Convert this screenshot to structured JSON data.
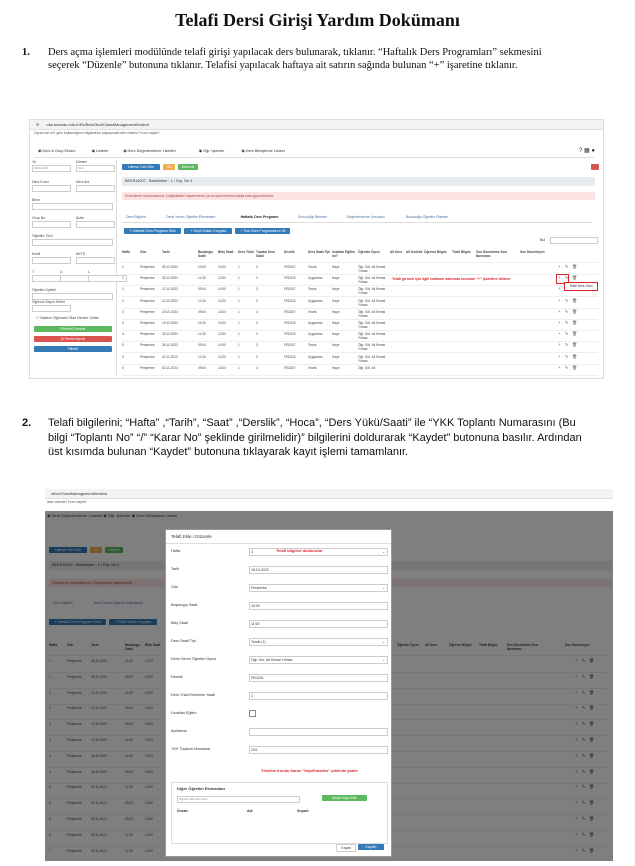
{
  "title": "Telafi Dersi Girişi Yardım Dokümanı",
  "steps": [
    {
      "num": "1.",
      "text": "Ders açma işlemleri modülünde telafi girişi yapılacak ders bulunarak, tıklanır. “Haftalık Ders Programları” sekmesini seçerek “Düzenle” butonuna tıklanır. Telafisi yapılacak haftaya ait satırın sağında bulunan “+” işaretine tıklanır."
    },
    {
      "num": "2.",
      "text": "Telafi bilgilerini; “Hafta” ,“Tarih”, “Saat” ,“Derslik”, “Hoca”, “Ders Yükü/Saati” ile “YKK Toplantı Numarasını (Bu bilgi “Toplantı No” “/” “Karar No” şeklinde girilmelidir)” bilgilerini doldurarak “Kaydet” butonuna basılır. Ardından üst kısımda bulunan “Kaydet” butonuna tıklayarak kayıt işlemi tamamlanır."
    }
  ],
  "shot1": {
    "url": "obs.batman.edu.tr/Ek/BelsOkul/ClassManagement/Index#",
    "notice": "Oyunu'lar mi? girin kullandığınız bilgilerinizi paylaşmak ister misiniz? Kuru sayfa?",
    "topnav": [
      "Ders & Grup Ekranı",
      "Listeler",
      "Ders Değerlendirme Listeleri",
      "Öğr. İşlemler",
      "Ders Birleştirme Listesi"
    ],
    "left_labels": [
      "Yıl",
      "Dönem",
      "Ders Kodu",
      "Ders Adı",
      "Birim",
      "Grup No",
      "Şube",
      "Öğretim Türü",
      "Kredi",
      "AKTS",
      "T",
      "U",
      "L",
      "Öğretim Üyeleri",
      "Öğrenci Sayısı Kriteri"
    ],
    "year_value": "2023-2024",
    "term_value": "Güz",
    "left_checkbox_label": "Sadece Öğrencisi Olan Dersler Gelsin",
    "left_buttons": [
      "Filtreleri Temizle",
      "Şi Temsil Ayrıntı",
      "Filtrele"
    ],
    "actions": [
      "Listeye Geri Dön",
      "Sil",
      "Düzenle"
    ],
    "course_bar": "BEKS14007 - Badminton - 1 / Grp. No:1",
    "warning": "Düzenleme modundasınız. Değişiklikleri kaydetmeniz ya da iptal etmeniz başka hata giysindenizde.",
    "tabs": [
      "Ders Bilgileri",
      "Dersi Veren Öğretim Elemanları",
      "Haftalık Ders Programı",
      "Sonuç/Ağı Birimler",
      "Değerlendirme Unsurları",
      "Bazadağa Öğretim Planları"
    ],
    "tab_buttons": [
      "Haftalık Ders Programı Ekle",
      "Seçili Kalları Kopyala",
      "Tüm Ders Programlarını Sil"
    ],
    "search_label": "Bul",
    "columns": [
      "Hafta",
      "Gün",
      "Tarih",
      "Başlangıç Saati",
      "Bitiş Saati",
      "Ders Yükü",
      "Toplam Ders Saati",
      "Derslik",
      "Ders Saati Tipi",
      "Uzaktan Eğitim mi?",
      "Öğretim Üyesi",
      "Alt Ders",
      "Alt Kod/Alt",
      "Öğrenci Bilgisi",
      "Telafi Bilgisi",
      "Son Düzenleme Sıra Numarası",
      "Son Düzenleyen"
    ],
    "rows": [
      [
        "1",
        "Perşembe",
        "05.10.2023",
        "10:00",
        "12:00",
        "1",
        "3",
        "FED207",
        "Teorik",
        "Hayır",
        "Öğr. Gör. Ali Kemal Yılmaz"
      ],
      [
        "1",
        "Perşembe",
        "05.10.2023",
        "11:00",
        "12:00",
        "1",
        "3",
        "FED242",
        "Uygulama",
        "Hayır",
        "Öğr. Gör. Ali Kemal Yılmaz"
      ],
      [
        "2",
        "Perşembe",
        "12.10.2023",
        "09:00",
        "10:00",
        "1",
        "3",
        "FED207",
        "Teorik",
        "Hayır",
        "Öğr. Gör. Ali Kemal Yılmaz"
      ],
      [
        "2",
        "Perşembe",
        "12.10.2023",
        "11:00",
        "12:00",
        "1",
        "3",
        "FED242",
        "Uygulama",
        "Hayır",
        "Öğr. Gör. Ali Kemal Yılmaz"
      ],
      [
        "3",
        "Perşembe",
        "19.10.2023",
        "09:00",
        "10:00",
        "1",
        "3",
        "FED207",
        "Teorik",
        "Hayır",
        "Öğr. Gör. Ali Kemal Yılmaz"
      ],
      [
        "3",
        "Perşembe",
        "19.10.2023",
        "11:00",
        "12:00",
        "1",
        "3",
        "FED242",
        "Uygulama",
        "Hayır",
        "Öğr. Gör. Ali Kemal Yılmaz"
      ],
      [
        "4",
        "Perşembe",
        "26.10.2023",
        "11:00",
        "12:00",
        "1",
        "3",
        "FED242",
        "Uygulama",
        "Hayır",
        "Öğr. Gör. Ali Kemal Yılmaz"
      ],
      [
        "5",
        "Perşembe",
        "26.10.2023",
        "09:00",
        "10:00",
        "1",
        "3",
        "FED207",
        "Teorik",
        "Hayır",
        "Öğr. Gör. Ali Kemal Yılmaz"
      ],
      [
        "5",
        "Perşembe",
        "02.11.2023",
        "11:00",
        "12:00",
        "1",
        "3",
        "FED242",
        "Uygulama",
        "Hayır",
        "Öğr. Gör. Ali Kemal Yılmaz"
      ],
      [
        "6",
        "Perşembe",
        "02.11.2023",
        "09:00",
        "10:00",
        "1",
        "3",
        "FED207",
        "Teorik",
        "Hayır",
        "Öğr. Gör. Ali"
      ]
    ],
    "annotation": "Telafi girmek için ilgili haftanın satırında bulunan \"+\" işaretine tıklanır",
    "tooltip": "Telafi Ders Gisin"
  },
  "shot2": {
    "url": "ofice/ClassManagement/Index#",
    "notice": "ister misiniz? Kuru sayfa?",
    "modal_title": "Telafi Ekle / Düzenle",
    "fields": [
      {
        "label": "Hafta",
        "value": "3"
      },
      {
        "label": "Tarih",
        "value": "18.10.2023"
      },
      {
        "label": "Gün",
        "value": "Perşembe"
      },
      {
        "label": "Başlangıç Saati",
        "value": "10:00"
      },
      {
        "label": "Bitiş Saati",
        "value": "11:00"
      },
      {
        "label": "Ders Saati Tipi",
        "value": "Teorik (1)"
      },
      {
        "label": "Dersi Veren Öğretim Üyesi",
        "value": "Öğr. Gör. Ali Kemal Yılmaz"
      },
      {
        "label": "Derslik",
        "value": "FED201"
      },
      {
        "label": "Ders Yükü/Yineleme Saati",
        "value": "1"
      },
      {
        "label": "Uzaktan Eğitim",
        "value": ""
      },
      {
        "label": "Açıklama",
        "value": ""
      },
      {
        "label": "YKK Toplantı Numarası",
        "value": "22/1"
      }
    ],
    "annotation_top": "Telafi bilgileri doldurulur",
    "annotation_ykk": "Yönetim Kurulu Kararı \"Sayı/KararNo\" şeklinde yazılır",
    "sub_title": "Diğer Öğretim Elemanları",
    "sub_search_placeholder": "Öğretim Elemanı Ara...",
    "sub_add_button": "Seçili Kişiyi Ekle",
    "sub_columns": [
      "Ünvan",
      "Adı",
      "Soyadı"
    ],
    "cancel": "Kapat",
    "save": "Kaydet",
    "bg_actions": [
      "Listeye Geri Dön",
      "Sil",
      "Kaydet"
    ],
    "bg_course": "BEKS14007 - Badminton - 1 / Grp. No:1",
    "bg_warning": "Düzenleme modundasınız. Değişiklikleri kaydetmeniz",
    "bg_tabs": [
      "Ders Bilgileri",
      "Dersi Veren Öğretim Elemanları",
      "Haf"
    ],
    "bg_buttons": [
      "Haftalık Ders Programı Ekle",
      "Seçili Kalları Kopyala"
    ],
    "bg_columns": [
      "Hafta",
      "Gün",
      "Tarih",
      "Başlangıç Saati",
      "Bitiş Saati"
    ],
    "bg_right_columns": [
      "Öğretim Üyesi",
      "Alt Ders",
      "Öğrenci Bilgisi",
      "Telafi Bilgisi",
      "Son Düzenleme Sıra Numarası",
      "Son Düzenleyen"
    ],
    "bg_rows": [
      [
        "1",
        "Perşembe",
        "05.10.2023",
        "11:00",
        "12:00"
      ],
      [
        "1",
        "Perşembe",
        "05.10.2023",
        "09:00",
        "10:00"
      ],
      [
        "2",
        "Perşembe",
        "12.10.2023",
        "11:00",
        "12:00"
      ],
      [
        "2",
        "Perşembe",
        "12.10.2023",
        "09:00",
        "10:00"
      ],
      [
        "3",
        "Perşembe",
        "19.10.2023",
        "09:00",
        "10:00"
      ],
      [
        "3",
        "Perşembe",
        "19.10.2023",
        "11:00",
        "12:00"
      ],
      [
        "4",
        "Perşembe",
        "26.10.2023",
        "11:00",
        "12:00"
      ],
      [
        "4",
        "Perşembe",
        "26.10.2023",
        "09:00",
        "10:00"
      ],
      [
        "5",
        "Perşembe",
        "02.11.2023",
        "11:00",
        "12:00"
      ],
      [
        "5",
        "Perşembe",
        "02.11.2023",
        "09:00",
        "10:00"
      ],
      [
        "6",
        "Perşembe",
        "09.11.2023",
        "09:00",
        "10:00"
      ],
      [
        "6",
        "Perşembe",
        "09.11.2023",
        "11:00",
        "12:00"
      ],
      [
        "7",
        "Perşembe",
        "16.11.2023",
        "11:00",
        "12:00"
      ]
    ],
    "bg_bottom_rows": [
      [
        "FED242",
        "Uygulama",
        "Hayır",
        "Öğr. Gör. Ali Kemal Yılmaz"
      ],
      [
        "FED207",
        "Teorik",
        "Hayır",
        "Öğr. Gör. Ali Kemal Yılmaz"
      ],
      [
        "FED242",
        "Uygulama",
        "Hayır",
        "Öğr. Gör. Ali Kemal Yılmaz"
      ],
      [
        "FED207",
        "Teorik",
        "Hayır",
        "Öğr. Gör. Ali Kemal Yılmaz"
      ]
    ],
    "colors": {
      "primary": "#337ab7",
      "success": "#5cb85c",
      "danger": "#d9534f",
      "warning": "#f0ad4e",
      "annotation": "#d9262b"
    }
  }
}
